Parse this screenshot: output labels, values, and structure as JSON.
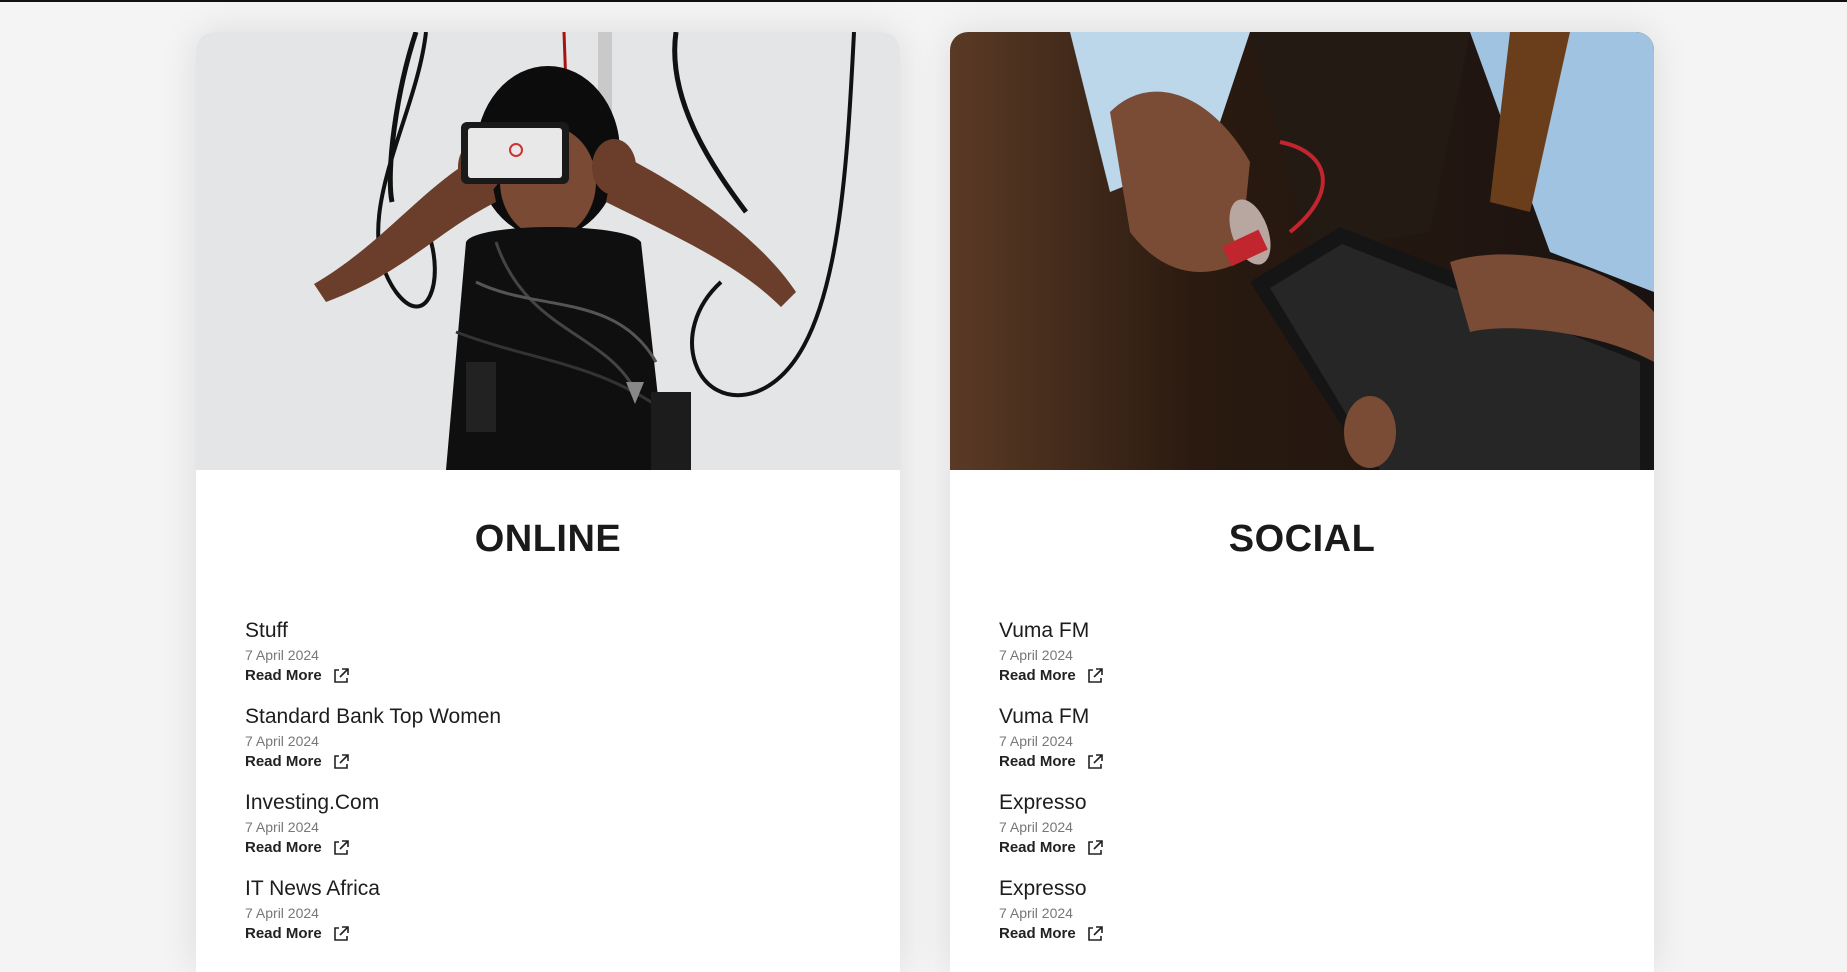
{
  "cards": [
    {
      "title": "ONLINE",
      "image": "woman-with-phone-over-eyes-and-hanging-cables",
      "items": [
        {
          "title": "Stuff",
          "date": "7 April 2024",
          "link": "Read More"
        },
        {
          "title": "Standard Bank Top Women",
          "date": "7 April 2024",
          "link": "Read More"
        },
        {
          "title": "Investing.Com",
          "date": "7 April 2024",
          "link": "Read More"
        },
        {
          "title": "IT News Africa",
          "date": "7 April 2024",
          "link": "Read More"
        }
      ]
    },
    {
      "title": "SOCIAL",
      "image": "hands-plugging-charger-into-phone",
      "items": [
        {
          "title": "Vuma FM",
          "date": "7 April 2024",
          "link": "Read More"
        },
        {
          "title": "Vuma FM",
          "date": "7 April 2024",
          "link": "Read More"
        },
        {
          "title": "Expresso",
          "date": "7 April 2024",
          "link": "Read More"
        },
        {
          "title": "Expresso",
          "date": "7 April 2024",
          "link": "Read More"
        }
      ]
    }
  ],
  "icons": {
    "external_link": "external-link-icon"
  },
  "colors": {
    "page_background": "#f4f4f4",
    "card_background": "#ffffff",
    "heading_text": "#1a1a1a",
    "date_text": "#777777"
  }
}
